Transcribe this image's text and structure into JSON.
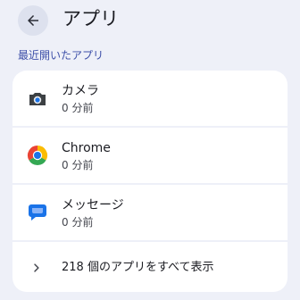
{
  "header": {
    "title": "アプリ",
    "back_icon": "arrow-back-icon"
  },
  "recent": {
    "label": "最近開いたアプリ",
    "apps": [
      {
        "name": "カメラ",
        "time": "0 分前",
        "icon": "camera-icon"
      },
      {
        "name": "Chrome",
        "time": "0 分前",
        "icon": "chrome-icon"
      },
      {
        "name": "メッセージ",
        "time": "0 分前",
        "icon": "messages-icon"
      }
    ]
  },
  "show_all": {
    "label": "218 個のアプリをすべて表示",
    "icon": "chevron-right-icon"
  },
  "colors": {
    "background": "#eef0f8",
    "card": "#ffffff",
    "accent": "#3d4fa8",
    "back_button": "#dde1ee"
  }
}
